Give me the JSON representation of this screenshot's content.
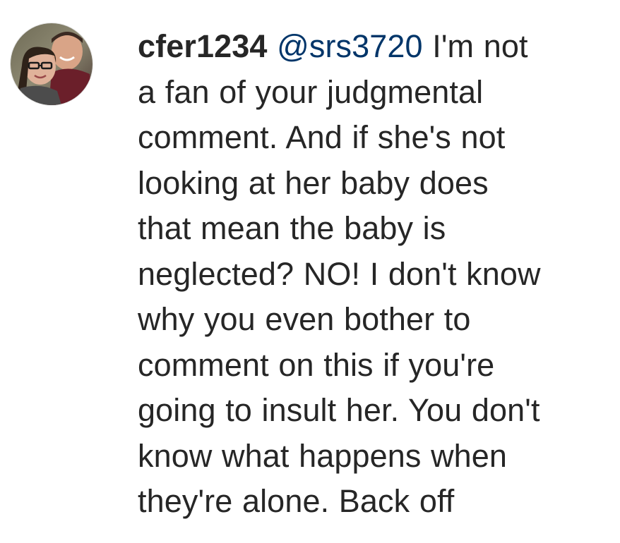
{
  "comment": {
    "username": "cfer1234",
    "mention": "@srs3720",
    "first_line_rest": "I'm not",
    "text_lines": [
      "a fan of your judgmental",
      "comment. And if she's not",
      "looking at her baby does",
      "that mean the baby is",
      "neglected? NO! I don't know",
      "why you even bother to",
      "comment on this if you're",
      "going to insult her. You don't",
      "know what happens when",
      "they're alone. Back off"
    ]
  },
  "colors": {
    "text": "#262626",
    "mention": "#003569",
    "background": "#ffffff"
  }
}
